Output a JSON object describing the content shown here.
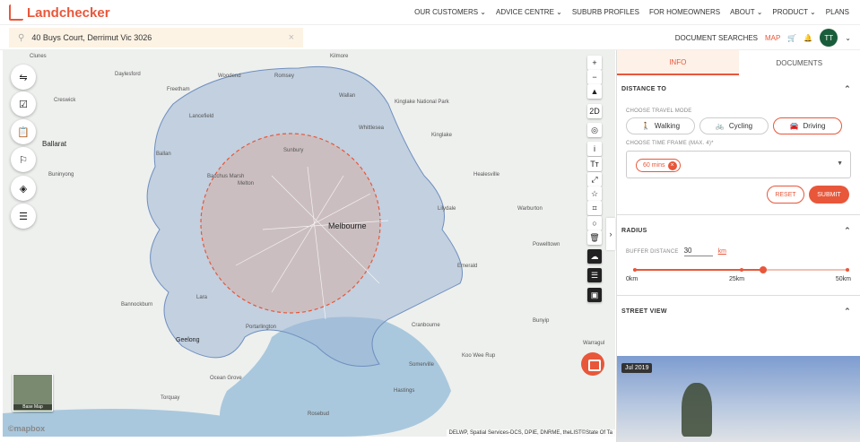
{
  "brand": {
    "name": "Landchecker",
    "color": "#e8573a"
  },
  "nav": [
    "OUR CUSTOMERS ⌄",
    "ADVICE CENTRE ⌄",
    "SUBURB PROFILES",
    "FOR HOMEOWNERS",
    "ABOUT ⌄",
    "PRODUCT ⌄",
    "PLANS"
  ],
  "search": {
    "value": "40 Buys Court, Derrimut Vic 3026"
  },
  "toolbar": {
    "doc_search": "DOCUMENT SEARCHES",
    "map": "MAP",
    "avatar": "TT"
  },
  "map": {
    "labels": [
      "Clunes",
      "Daylesford",
      "Kilmore",
      "Freetham",
      "Woodend",
      "Romsey",
      "Wallan",
      "Kinglake National Park",
      "Creswick",
      "Ballarat",
      "Lancefield",
      "Whittlesea",
      "Kinglake",
      "Ballan",
      "Buninyong",
      "Bacchus Marsh",
      "Melton",
      "Sunbury",
      "Healesville",
      "Lilydale",
      "Warburton",
      "Melbourne",
      "Powelltown",
      "Emerald",
      "Bannockburn",
      "Geelong",
      "Lara",
      "Portarlington",
      "Cranbourne",
      "Bunyip",
      "Warragul",
      "Koo Wee Rup",
      "Somerville",
      "Ocean Grove",
      "Torquay",
      "Hastings",
      "Rosebud"
    ],
    "basemap_label": "Base Map",
    "mapbox": "©mapbox",
    "attribution": "DELWP, Spatial Services-DCS, DPIE, DNRME, theLIST©State Of Ta",
    "controls": [
      "+",
      "−",
      "▲",
      "2D",
      "◎",
      "i",
      "Tт",
      "⤢",
      "☆",
      "⌗",
      "○",
      "🗑",
      "☁",
      "☰",
      "▣"
    ],
    "radius_color": "#e8573a",
    "isochrone_color": "#9fb7d6"
  },
  "panel": {
    "tabs": [
      "INFO",
      "DOCUMENTS"
    ],
    "distance": {
      "title": "DISTANCE TO",
      "mode_label": "CHOOSE TRAVEL MODE",
      "modes": [
        "Walking",
        "Cycling",
        "Driving"
      ],
      "time_label": "CHOOSE TIME FRAME (MAX. 4)*",
      "chip": "60 mins",
      "reset": "RESET",
      "submit": "SUBMIT"
    },
    "radius": {
      "title": "RADIUS",
      "buffer_label": "BUFFER DISTANCE",
      "buffer_value": "30",
      "unit": "km",
      "slider_value_km": 30,
      "slider_max_km": 50,
      "ticks": [
        "0km",
        "25km",
        "50km"
      ]
    },
    "street_view": {
      "title": "STREET VIEW",
      "date": "Jul 2019"
    }
  }
}
